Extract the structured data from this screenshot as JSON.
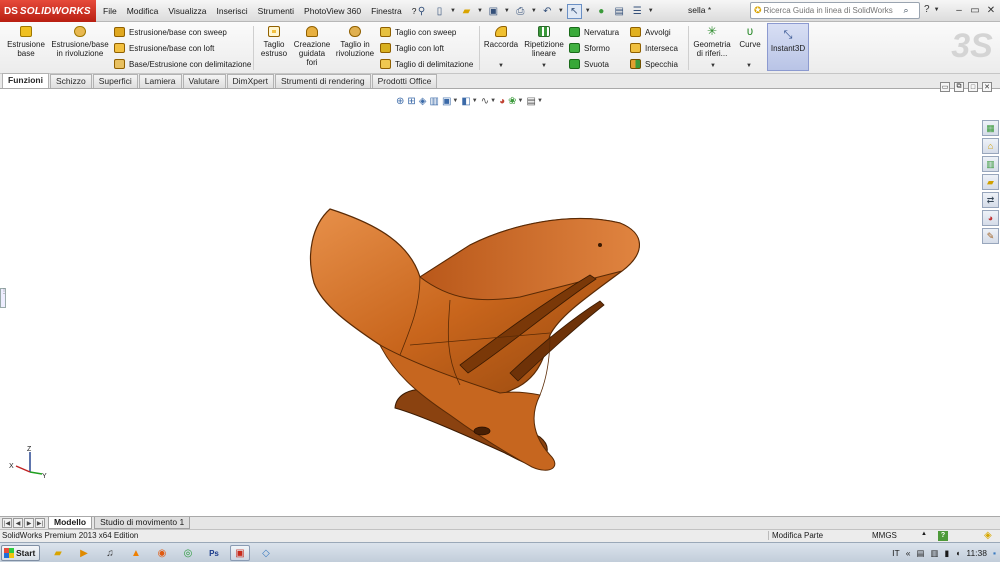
{
  "app": {
    "logo_mark": "DS",
    "logo_text": "SOLIDWORKS",
    "document_title": "sella *",
    "search_placeholder": "Ricerca Guida in linea di SolidWorks"
  },
  "menu": [
    "File",
    "Modifica",
    "Visualizza",
    "Inserisci",
    "Strumenti",
    "PhotoView 360",
    "Finestra",
    "?"
  ],
  "ribbon": {
    "estrusione_base": "Estrusione\nbase",
    "estrusione_rivoluzione": "Estrusione/base\nin rivoluzione",
    "estrusione_sweep": "Estrusione/base con sweep",
    "estrusione_loft": "Estrusione/base con loft",
    "base_delimitazione": "Base/Estrusione con delimitazione",
    "taglio_estruso": "Taglio\nestruso",
    "creazione_fori": "Creazione\nguidata\nfori",
    "taglio_rivoluzione": "Taglio in\nrivoluzione",
    "taglio_sweep": "Taglio con sweep",
    "taglio_loft": "Taglio con loft",
    "taglio_delimitazione": "Taglio di delimitazione",
    "raccorda": "Raccorda",
    "ripetizione_lineare": "Ripetizione\nlineare",
    "nervatura": "Nervatura",
    "sformo": "Sformo",
    "svuota": "Svuota",
    "avvolgi": "Avvolgi",
    "interseca": "Interseca",
    "specchia": "Specchia",
    "geometria_riferimento": "Geometria\ndi riferi...",
    "curve": "Curve",
    "instant3d": "Instant3D"
  },
  "tabs": [
    "Funzioni",
    "Schizzo",
    "Superfici",
    "Lamiera",
    "Valutare",
    "DimXpert",
    "Strumenti di rendering",
    "Prodotti Office"
  ],
  "active_tab": "Funzioni",
  "triad": {
    "z": "Z",
    "x": "X",
    "y": "Y"
  },
  "model_tabs": [
    "Modello",
    "Studio di movimento 1"
  ],
  "status": {
    "edition": "SolidWorks Premium 2013 x64 Edition",
    "mode": "Modifica Parte",
    "units": "MMGS",
    "help": "?"
  },
  "taskbar": {
    "start": "Start",
    "language": "IT",
    "time": "11:38"
  },
  "colors": {
    "part_main": "#c8651c",
    "part_light": "#e7904a",
    "part_dark": "#7a3808",
    "accent_red": "#c82a1c",
    "selection_blue": "#b9c4e6"
  }
}
